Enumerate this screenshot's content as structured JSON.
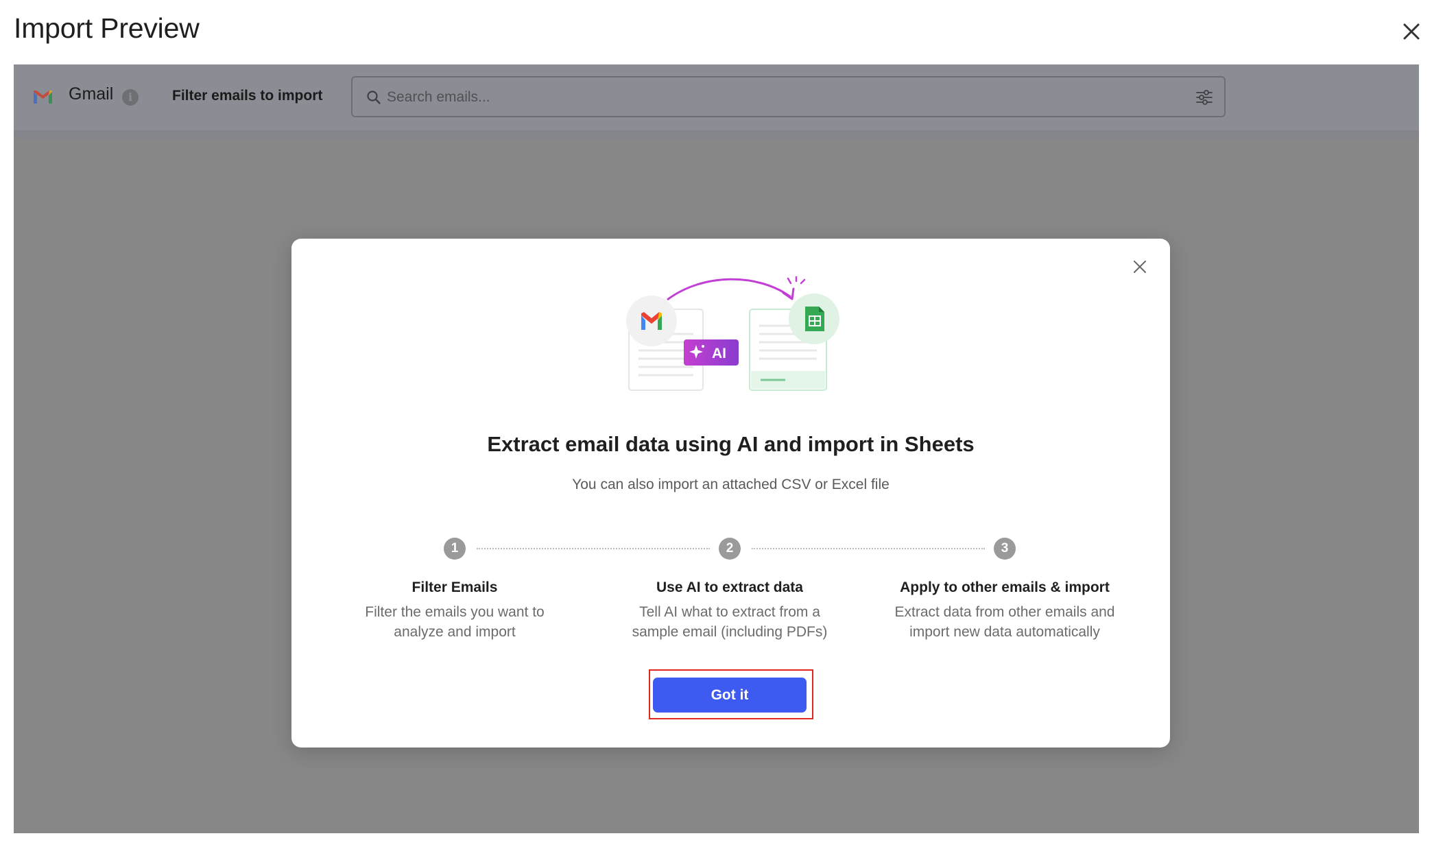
{
  "header": {
    "title": "Import Preview"
  },
  "toolbar": {
    "source_name": "Gmail",
    "info_glyph": "i",
    "filter_label": "Filter emails to import",
    "search_placeholder": "Search emails...",
    "search_value": ""
  },
  "modal": {
    "illustration_badge": "AI",
    "title": "Extract email data using AI and import in Sheets",
    "subtitle": "You can also import an attached CSV or Excel file",
    "steps": [
      {
        "number": "1",
        "title": "Filter Emails",
        "desc_line1": "Filter the emails you want to",
        "desc_line2": "analyze and import"
      },
      {
        "number": "2",
        "title": "Use AI to extract data",
        "desc_line1": "Tell AI what to extract from a",
        "desc_line2": "sample email (including PDFs)"
      },
      {
        "number": "3",
        "title": "Apply to other emails & import",
        "desc_line1": "Extract data from other emails and",
        "desc_line2": "import new data automatically"
      }
    ],
    "primary_button": "Got it"
  },
  "colors": {
    "overlay": "#878787",
    "primary_button": "#3d5af1",
    "highlight_border": "#e0281c",
    "ai_badge_start": "#c43fd0",
    "ai_badge_end": "#8a3ccf",
    "arrow": "#c23fd6",
    "sheets_green": "#34a853"
  },
  "icons": [
    "close-icon",
    "gmail-logo-icon",
    "info-icon",
    "search-icon",
    "filter-settings-icon",
    "sheets-icon",
    "sparkle-icon"
  ]
}
